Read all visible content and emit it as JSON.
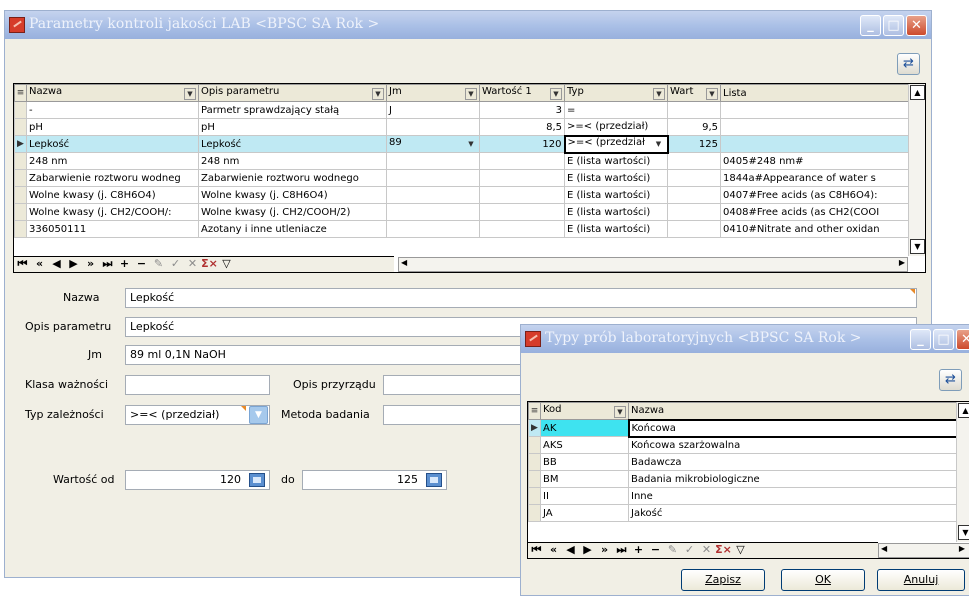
{
  "main": {
    "title": "Parametry kontroli jakości LAB <BPSC SA Rok >",
    "columns": [
      "Nazwa",
      "Opis parametru",
      "Jm",
      "Wartość 1",
      "Typ",
      "Wart",
      "Lista"
    ],
    "rows": [
      {
        "nazwa": "-",
        "opis": "Parmetr sprawdzający stałą",
        "jm": "J",
        "wart1": "3",
        "typ": "=",
        "wart2": "",
        "lista": ""
      },
      {
        "nazwa": "pH",
        "opis": "pH",
        "jm": "",
        "wart1": "8,5",
        "typ": ">=< (przedział)",
        "wart2": "9,5",
        "lista": ""
      },
      {
        "nazwa": "Lepkość",
        "opis": "Lepkość",
        "jm": "89",
        "wart1": "120",
        "typ": ">=< (przedział",
        "wart2": "125",
        "lista": ""
      },
      {
        "nazwa": "248 nm",
        "opis": "248 nm",
        "jm": "",
        "wart1": "",
        "typ": "E (lista wartości)",
        "wart2": "",
        "lista": "0405#248 nm#"
      },
      {
        "nazwa": "Zabarwienie roztworu wodneg",
        "opis": "Zabarwienie roztworu wodnego",
        "jm": "",
        "wart1": "",
        "typ": "E (lista wartości)",
        "wart2": "",
        "lista": "1844a#Appearance of water s"
      },
      {
        "nazwa": "Wolne kwasy (j. C8H6O4)",
        "opis": "Wolne kwasy (j. C8H6O4)",
        "jm": "",
        "wart1": "",
        "typ": "E (lista wartości)",
        "wart2": "",
        "lista": "0407#Free acids (as C8H6O4):"
      },
      {
        "nazwa": "Wolne kwasy (j. CH2/COOH/:",
        "opis": "Wolne kwasy (j. CH2/COOH/2)",
        "jm": "",
        "wart1": "",
        "typ": "E (lista wartości)",
        "wart2": "",
        "lista": "0408#Free acids (as CH2(COOI"
      },
      {
        "nazwa": "336050111",
        "opis": "Azotany i inne utleniacze",
        "jm": "",
        "wart1": "",
        "typ": "E (lista wartości)",
        "wart2": "",
        "lista": "0410#Nitrate and other oxidan"
      }
    ],
    "form": {
      "nazwa_label": "Nazwa",
      "nazwa_value": "Lepkość",
      "opis_label": "Opis parametru",
      "opis_value": "Lepkość",
      "jm_label": "Jm",
      "jm_value": "89   ml 0,1N NaOH",
      "klasa_label": "Klasa ważności",
      "klasa_value": "",
      "opis_przyrzadu_label": "Opis przyrządu",
      "opis_przyrzadu_value": "",
      "typ_label": "Typ zależności",
      "typ_value": ">=< (przedział)",
      "metoda_label": "Metoda badania",
      "metoda_value": "",
      "wartosc_od_label": "Wartość od",
      "wartosc_od_value": "120",
      "do_label": "do",
      "do_value": "125"
    }
  },
  "dialog": {
    "title": "Typy prób laboratoryjnych <BPSC SA Rok >",
    "columns": [
      "Kod",
      "Nazwa"
    ],
    "rows": [
      {
        "kod": "AK",
        "nazwa": "Końcowa"
      },
      {
        "kod": "AKS",
        "nazwa": "Końcowa szarżowalna"
      },
      {
        "kod": "BB",
        "nazwa": "Badawcza"
      },
      {
        "kod": "BM",
        "nazwa": "Badania mikrobiologiczne"
      },
      {
        "kod": "II",
        "nazwa": "Inne"
      },
      {
        "kod": "JA",
        "nazwa": "Jakość"
      }
    ],
    "buttons": {
      "save": "Zapisz",
      "ok": "OK",
      "cancel": "Anuluj"
    }
  },
  "colors": {
    "selected_row": "#bfe9f3",
    "active_cell": "#3ee3f0",
    "titlebar": "#a9bfe6",
    "close_button": "#cd4a2c"
  }
}
